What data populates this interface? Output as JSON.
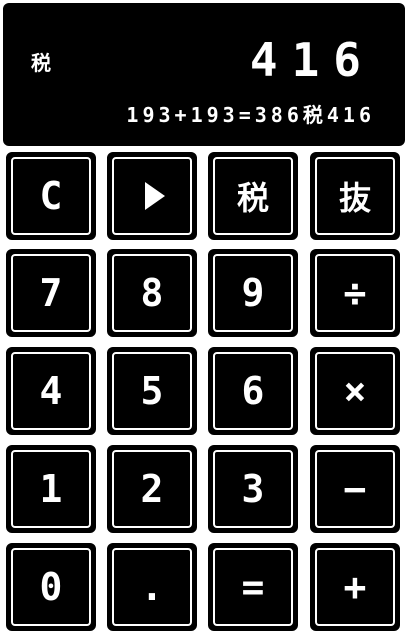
{
  "display": {
    "tax_indicator": "税",
    "main_value": "416",
    "history": "193+193=386税416"
  },
  "keys": {
    "clear": "C",
    "play": "play-icon",
    "tax_in": "税",
    "tax_out": "抜",
    "seven": "7",
    "eight": "8",
    "nine": "9",
    "divide": "÷",
    "four": "4",
    "five": "5",
    "six": "6",
    "multiply": "×",
    "one": "1",
    "two": "2",
    "three": "3",
    "minus": "−",
    "zero": "0",
    "dot": ".",
    "equals": "=",
    "plus": "+"
  },
  "colors": {
    "background": "#ffffff",
    "key_fill": "#000000",
    "key_text": "#ffffff"
  }
}
